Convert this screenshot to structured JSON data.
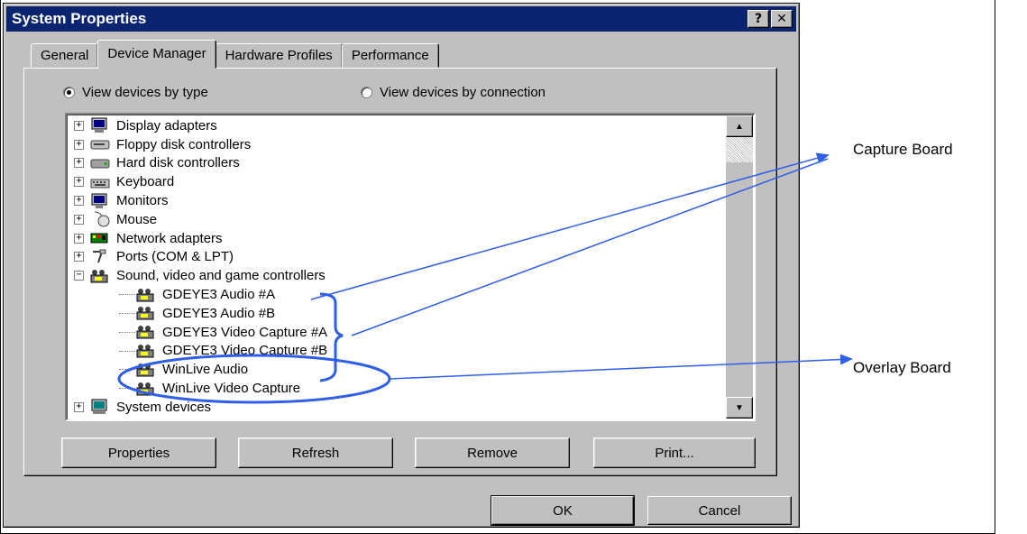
{
  "window": {
    "title": "System Properties",
    "help_label": "?",
    "close_label": "✕"
  },
  "tabs": [
    {
      "label": "General"
    },
    {
      "label": "Device Manager"
    },
    {
      "label": "Hardware Profiles"
    },
    {
      "label": "Performance"
    }
  ],
  "view_options": {
    "by_type": "View devices by type",
    "by_connection": "View devices by connection"
  },
  "tree": [
    {
      "label": "Display adapters",
      "icon": "display-icon",
      "expander": "+"
    },
    {
      "label": "Floppy disk controllers",
      "icon": "floppy-controller-icon",
      "expander": "+"
    },
    {
      "label": "Hard disk controllers",
      "icon": "hard-disk-controller-icon",
      "expander": "+"
    },
    {
      "label": "Keyboard",
      "icon": "keyboard-icon",
      "expander": "+"
    },
    {
      "label": "Monitors",
      "icon": "monitor-icon",
      "expander": "+"
    },
    {
      "label": "Mouse",
      "icon": "mouse-icon",
      "expander": "+"
    },
    {
      "label": "Network adapters",
      "icon": "network-adapter-icon",
      "expander": "+"
    },
    {
      "label": "Ports (COM & LPT)",
      "icon": "port-icon",
      "expander": "+"
    },
    {
      "label": "Sound, video and game controllers",
      "icon": "sound-video-icon",
      "expander": "−"
    }
  ],
  "sound_children": [
    {
      "label": "GDEYE3 Audio #A"
    },
    {
      "label": "GDEYE3 Audio #B"
    },
    {
      "label": "GDEYE3 Video Capture #A"
    },
    {
      "label": "GDEYE3 Video Capture #B"
    },
    {
      "label": "WinLive Audio"
    },
    {
      "label": "WinLive Video Capture"
    }
  ],
  "tree_last": {
    "label": "System devices",
    "icon": "system-devices-icon",
    "expander": "+"
  },
  "buttons": {
    "properties": "Properties",
    "refresh": "Refresh",
    "remove": "Remove",
    "print": "Print...",
    "ok": "OK",
    "cancel": "Cancel"
  },
  "annotations": {
    "capture_board": "Capture Board",
    "overlay_board": "Overlay Board"
  },
  "colors": {
    "titlebar": "#0a2470",
    "annotation": "#2f5fe8",
    "face": "#c0c0c0"
  }
}
